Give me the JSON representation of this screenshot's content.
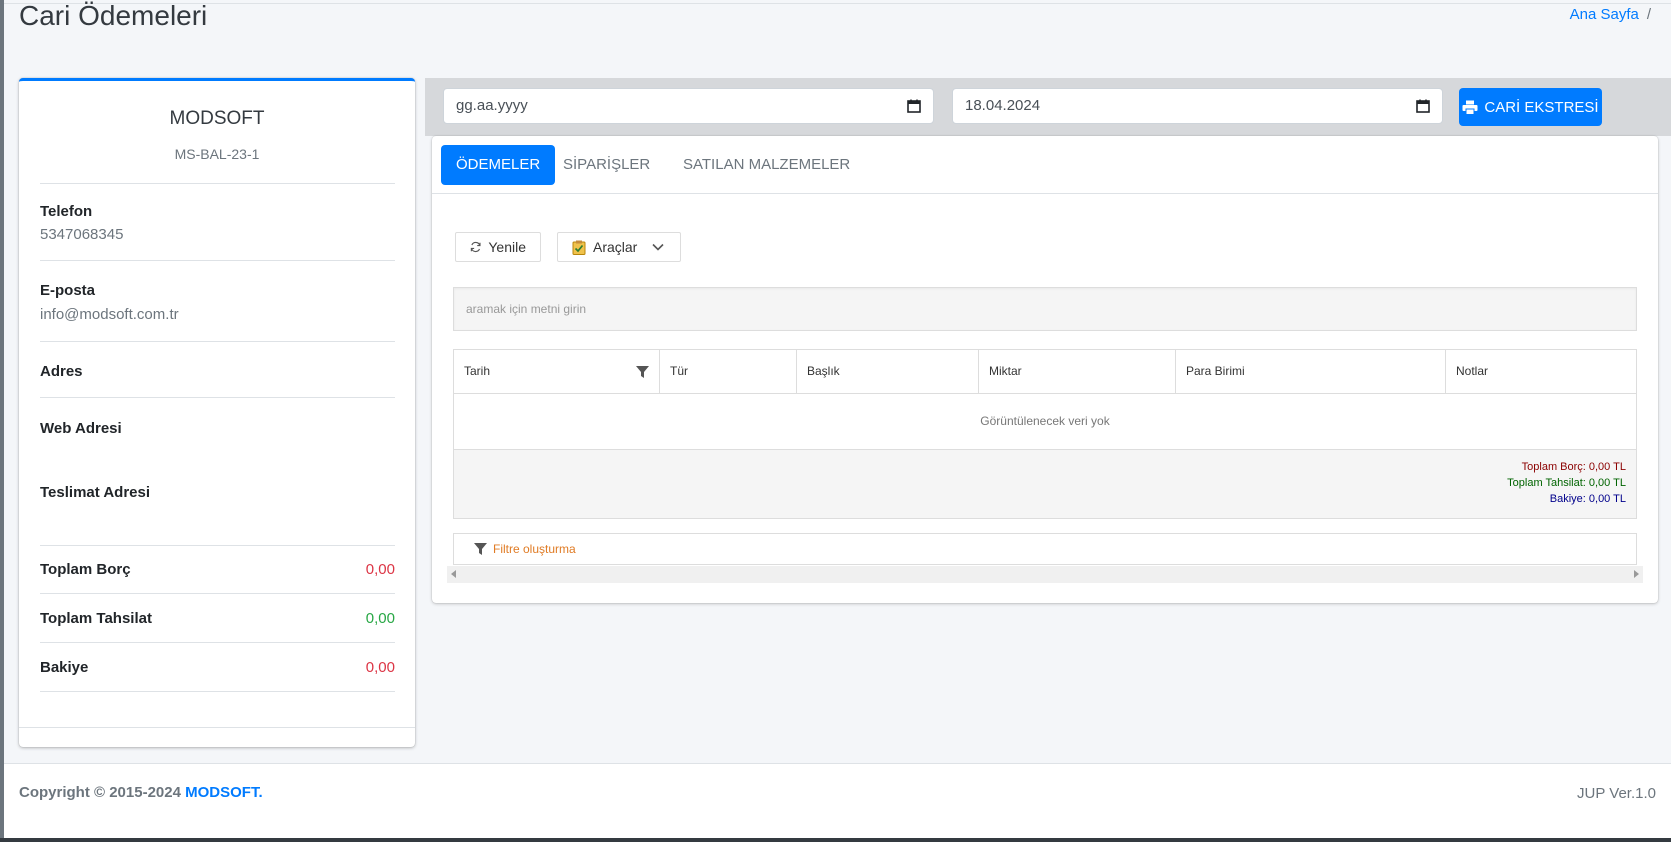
{
  "page": {
    "title": "Cari Ödemeleri"
  },
  "breadcrumb": {
    "home": "Ana Sayfa",
    "separator": "/"
  },
  "profile": {
    "company_name": "MODSOFT",
    "company_code": "MS-BAL-23-1",
    "phone_label": "Telefon",
    "phone_value": "5347068345",
    "email_label": "E-posta",
    "email_value": "info@modsoft.com.tr",
    "address_label": "Adres",
    "web_label": "Web Adresi",
    "delivery_label": "Teslimat Adresi",
    "total_debt_label": "Toplam Borç",
    "total_debt_value": "0,00",
    "total_collection_label": "Toplam Tahsilat",
    "total_collection_value": "0,00",
    "balance_label": "Bakiye",
    "balance_value": "0,00"
  },
  "dates": {
    "start": "gg.aa.yyyy",
    "end": "18.04.2024"
  },
  "print_button": "CARİ EKSTRESİ",
  "tabs": [
    "ÖDEMELER",
    "SİPARİŞLER",
    "SATILAN MALZEMELER"
  ],
  "toolbar": {
    "refresh": "Yenile",
    "tools": "Araçlar"
  },
  "search": {
    "placeholder": "aramak için metni girin"
  },
  "grid": {
    "columns": [
      "Tarih",
      "Tür",
      "Başlık",
      "Miktar",
      "Para Birimi",
      "Notlar"
    ],
    "no_data": "Görüntülenecek veri yok",
    "summary": {
      "debt": "Toplam Borç: 0,00 TL",
      "collection": "Toplam Tahsilat: 0,00 TL",
      "balance": "Bakiye: 0,00 TL"
    }
  },
  "filter": {
    "label": "Filtre oluşturma"
  },
  "footer": {
    "copyright": "Copyright © 2015-2024",
    "brand": "MODSOFT.",
    "version": "JUP Ver.1.0"
  },
  "colors": {
    "primary": "#007bff",
    "danger": "#dc3545",
    "success": "#28a745"
  }
}
